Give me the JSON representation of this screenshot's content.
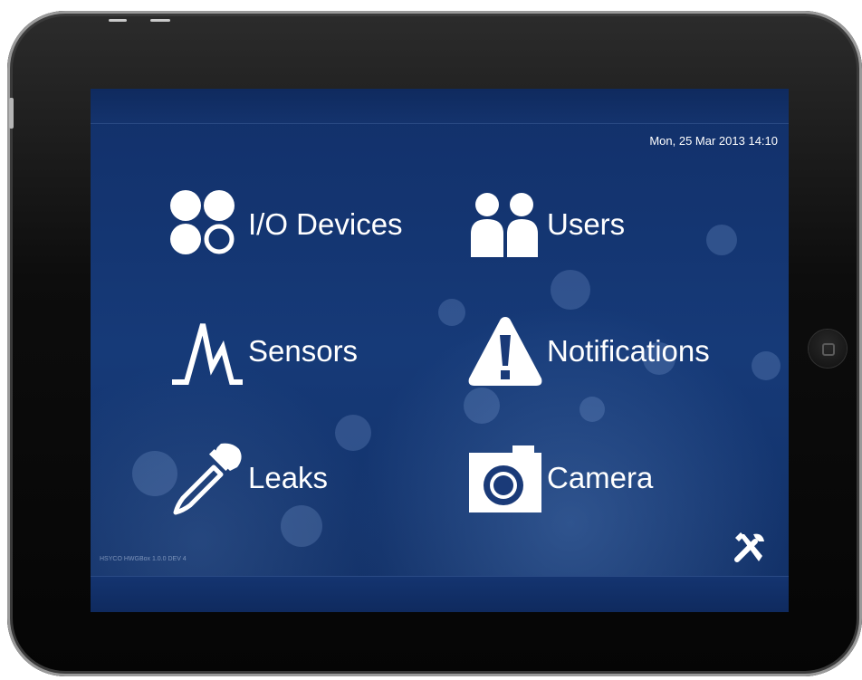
{
  "status": {
    "datetime": "Mon, 25 Mar 2013 14:10"
  },
  "menu": [
    {
      "label": "I/O Devices",
      "icon": "io-devices-icon"
    },
    {
      "label": "Users",
      "icon": "users-icon"
    },
    {
      "label": "Sensors",
      "icon": "sensors-icon"
    },
    {
      "label": "Notifications",
      "icon": "warning-icon"
    },
    {
      "label": "Leaks",
      "icon": "dropper-icon"
    },
    {
      "label": "Camera",
      "icon": "camera-icon"
    }
  ],
  "footer": {
    "version": "HSYCO HWGBox 1.0.0 DEV 4",
    "settings_icon": "tools-icon"
  },
  "colors": {
    "background": "#163a78",
    "text": "#ffffff",
    "bezel": "#0d0d0d"
  }
}
